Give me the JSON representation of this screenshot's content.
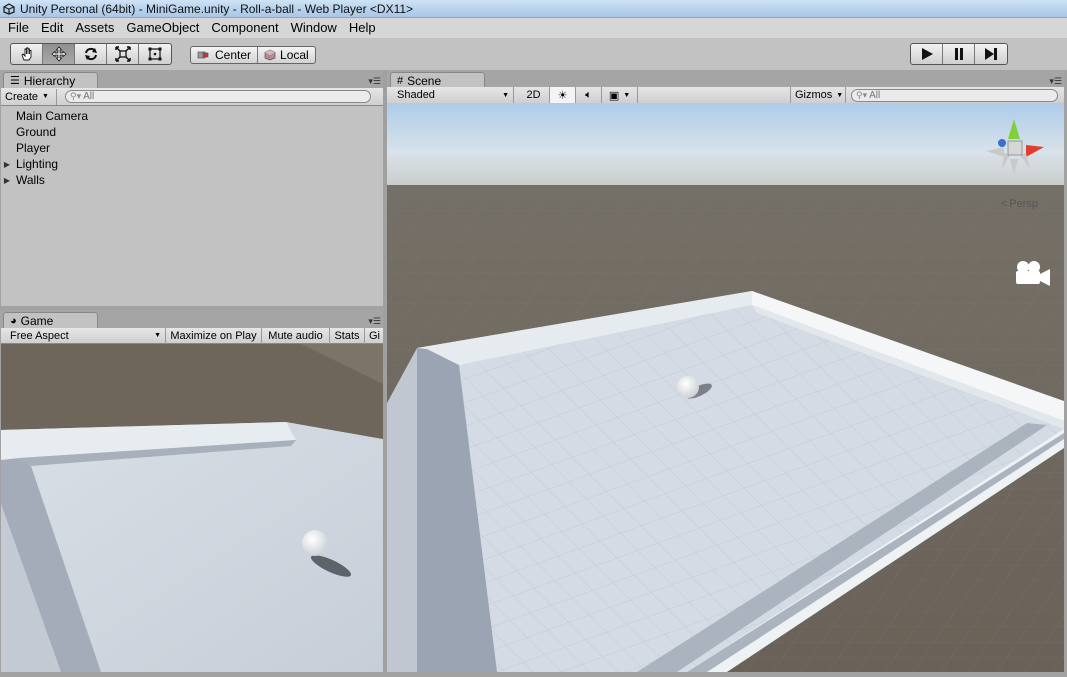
{
  "window": {
    "title": "Unity Personal (64bit) - MiniGame.unity - Roll-a-ball - Web Player <DX11>"
  },
  "menu": [
    "File",
    "Edit",
    "Assets",
    "GameObject",
    "Component",
    "Window",
    "Help"
  ],
  "toolbar": {
    "tools": [
      "hand-tool",
      "move-tool",
      "rotate-tool",
      "scale-tool",
      "rect-tool"
    ],
    "active_tool": "move-tool",
    "pivot_label": "Center",
    "space_label": "Local"
  },
  "hierarchy": {
    "tab": "Hierarchy",
    "create_label": "Create",
    "search_placeholder": "All",
    "items": [
      {
        "label": "Main Camera",
        "expandable": false
      },
      {
        "label": "Ground",
        "expandable": false
      },
      {
        "label": "Player",
        "expandable": false
      },
      {
        "label": "Lighting",
        "expandable": true
      },
      {
        "label": "Walls",
        "expandable": true
      }
    ]
  },
  "game": {
    "tab": "Game",
    "aspect": "Free Aspect",
    "maximize_label": "Maximize on Play",
    "mute_label": "Mute audio",
    "stats_label": "Stats",
    "gizmos_label": "Gi"
  },
  "scene": {
    "tab": "Scene",
    "shading": "Shaded",
    "mode_2d": "2D",
    "gizmos_label": "Gizmos",
    "search_placeholder": "All",
    "persp_label": "Persp"
  },
  "colors": {
    "sky_top": "#c9d6e1",
    "ground": "#6e655b",
    "floor": "#d6dde6",
    "wall": "#e9eef3"
  }
}
